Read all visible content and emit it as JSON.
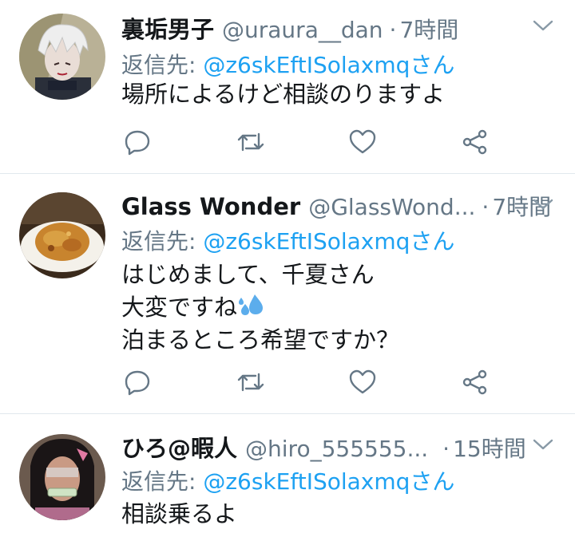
{
  "tweets": [
    {
      "name": "裏垢男子",
      "handle": "@uraura__dan",
      "separator": "·",
      "time": "7時間",
      "reply_prefix": "返信先: ",
      "reply_to": "@z6skEftISolaxmqさん",
      "lines": [
        "場所によるけど相談のりますよ"
      ],
      "avatar_icon": "anime-avatar-icon"
    },
    {
      "name": "Glass Wonder",
      "handle": "@GlassWond...",
      "separator": "·",
      "time": "7時間",
      "reply_prefix": "返信先: ",
      "reply_to": "@z6skEftISolaxmqさん",
      "lines": [
        "はじめまして、千夏さん",
        "大変ですね",
        "泊まるところ希望ですか？"
      ],
      "avatar_icon": "food-plate-avatar-icon"
    },
    {
      "name": "ひろ@暇人",
      "handle": "@hiro_555555...",
      "separator": "·",
      "time": "15時間",
      "reply_prefix": "返信先: ",
      "reply_to": "@z6skEftISolaxmqさん",
      "lines": [
        "相談乗るよ"
      ],
      "avatar_icon": "cosplay-avatar-icon"
    }
  ],
  "colors": {
    "text": "#14171a",
    "secondary": "#657786",
    "accent": "#1da1f2",
    "divider": "#e1e8ed"
  },
  "icons": [
    "reply-icon",
    "retweet-icon",
    "like-icon",
    "share-icon",
    "chevron-down-icon",
    "sweat-drops-emoji"
  ]
}
